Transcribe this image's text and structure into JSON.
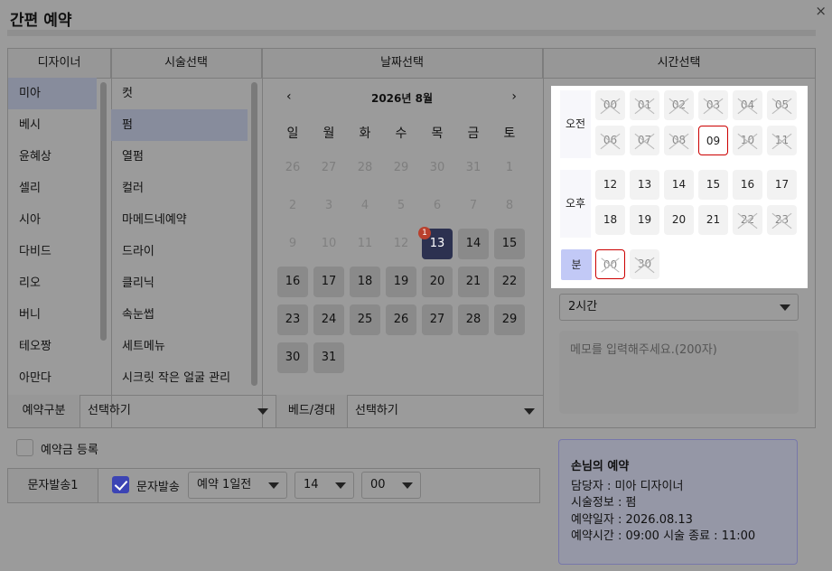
{
  "dialog": {
    "title": "간편 예약",
    "close": "×"
  },
  "columns": {
    "designer": "디자이너",
    "service": "시술선택",
    "date": "날짜선택",
    "time": "시간선택"
  },
  "designers": [
    "미아",
    "베시",
    "윤혜상",
    "셀리",
    "시아",
    "다비드",
    "리오",
    "버니",
    "테오짱",
    "아만다"
  ],
  "services": [
    "컷",
    "펌",
    "열펌",
    "컬러",
    "마메드네예약",
    "드라이",
    "클리닉",
    "속눈썹",
    "세트메뉴",
    "시크릿 작은 얼굴 관리"
  ],
  "calendar": {
    "month_label": "2026년 8월",
    "prev": "‹",
    "next": "›",
    "weekdays": [
      "일",
      "월",
      "화",
      "수",
      "목",
      "금",
      "토"
    ],
    "weeks": [
      [
        "26",
        "27",
        "28",
        "29",
        "30",
        "31",
        "1"
      ],
      [
        "2",
        "3",
        "4",
        "5",
        "6",
        "7",
        "8"
      ],
      [
        "9",
        "10",
        "11",
        "12",
        "13",
        "14",
        "15"
      ],
      [
        "16",
        "17",
        "18",
        "19",
        "20",
        "21",
        "22"
      ],
      [
        "23",
        "24",
        "25",
        "26",
        "27",
        "28",
        "29"
      ],
      [
        "30",
        "31",
        "",
        "",
        "",
        "",
        ""
      ]
    ],
    "selected": "13",
    "badge": "1"
  },
  "time": {
    "am_label": "오전",
    "pm_label": "오후",
    "minute_label": "분",
    "am_slots": [
      "00",
      "01",
      "02",
      "03",
      "04",
      "05",
      "06",
      "07",
      "08",
      "09",
      "10",
      "11"
    ],
    "pm_slots": [
      "12",
      "13",
      "14",
      "15",
      "16",
      "17",
      "18",
      "19",
      "20",
      "21",
      "22",
      "23"
    ],
    "minute_slots": [
      "00",
      "30"
    ],
    "duration": "2시간",
    "memo_placeholder": "메모를 입력해주세요.(200자)"
  },
  "booking_type": {
    "label": "예약구분",
    "value": "선택하기"
  },
  "bed": {
    "label": "베드/경대",
    "value": "선택하기"
  },
  "deposit_label": "예약금 등록",
  "sms": {
    "section_label": "문자발송1",
    "checkbox_label": "문자발송",
    "when": "예약 1일전",
    "hour": "14",
    "minute": "00"
  },
  "summary": {
    "title": "손님의 예약",
    "designer": "담당자 : 미아 디자이너",
    "service": "시술정보 : 펌",
    "date": "예약일자 : 2026.08.13",
    "time": "예약시간 : 09:00 시술 종료 : 11:00"
  }
}
